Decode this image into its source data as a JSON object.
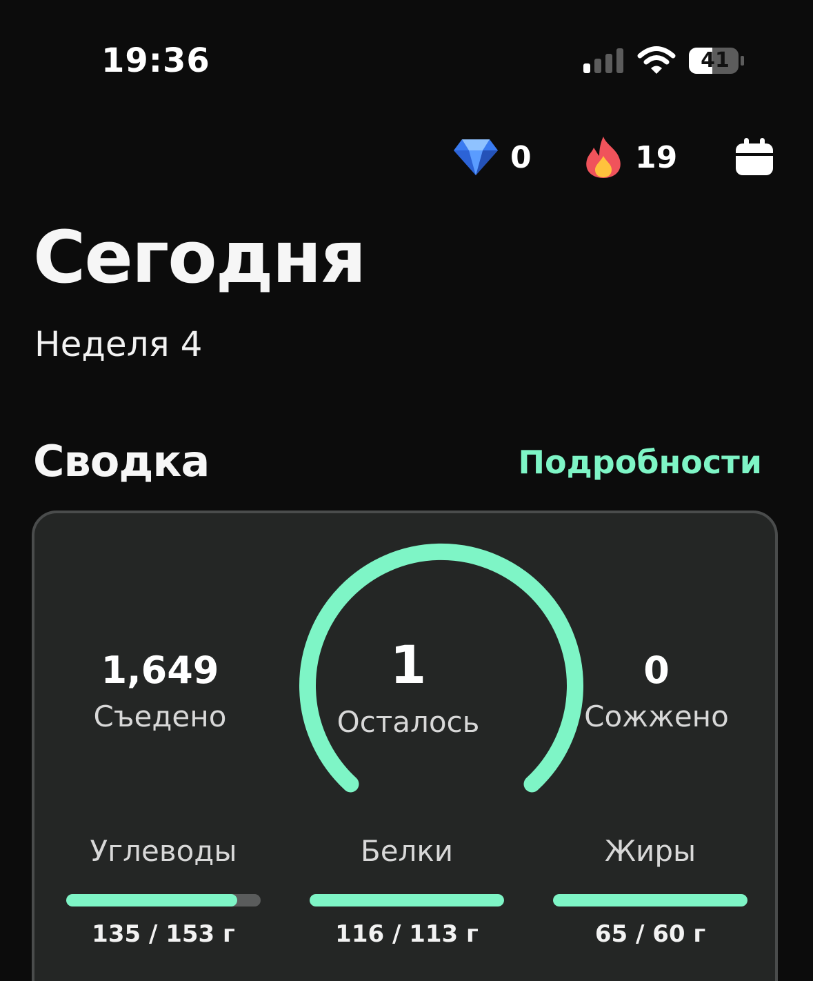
{
  "status_bar": {
    "time": "19:36",
    "battery_level": "41"
  },
  "header": {
    "gems_icon": "diamond-icon",
    "gems_count": "0",
    "streak_icon": "fire-icon",
    "streak_count": "19",
    "calendar_icon": "calendar-icon"
  },
  "title": "Сегодня",
  "subtitle": "Неделя 4",
  "summary": {
    "title": "Сводка",
    "details_link": "Подробности",
    "eaten_value": "1,649",
    "eaten_label": "Съедено",
    "remaining_value": "1",
    "remaining_label": "Осталось",
    "burned_value": "0",
    "burned_label": "Сожжено",
    "accent_color": "#7ef5c6",
    "macros": [
      {
        "name": "Углеводы",
        "amount": "135 / 153 г",
        "progress": 0.88
      },
      {
        "name": "Белки",
        "amount": "116 / 113 г",
        "progress": 1.0
      },
      {
        "name": "Жиры",
        "amount": "65 / 60 г",
        "progress": 1.0
      }
    ]
  }
}
